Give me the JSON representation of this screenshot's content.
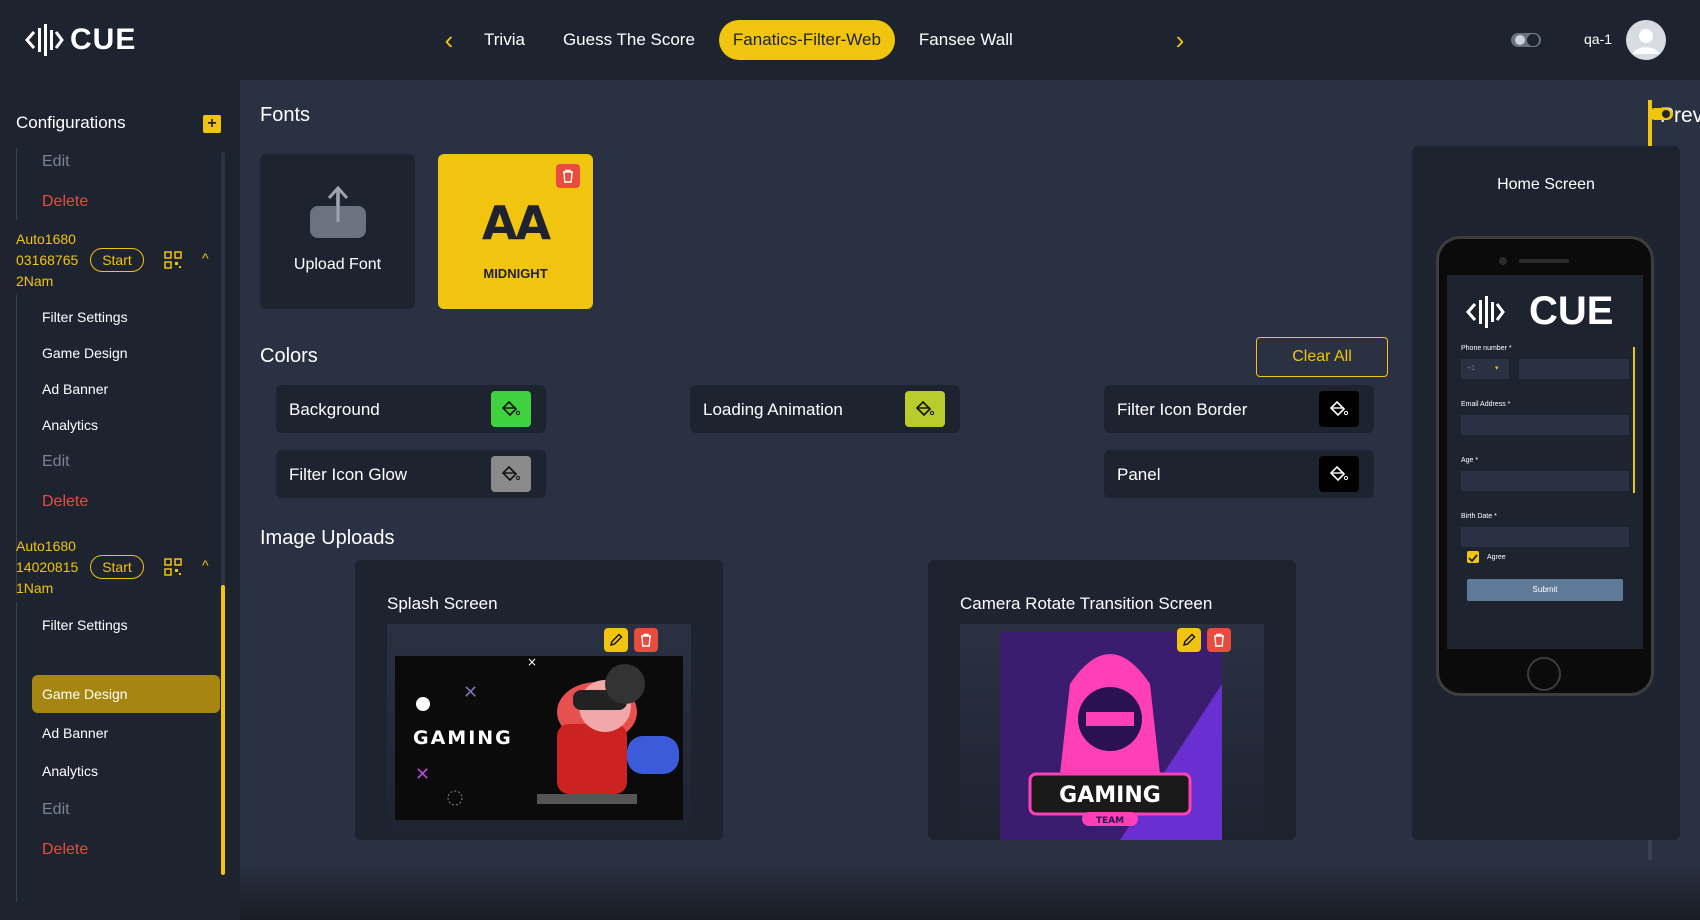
{
  "header": {
    "logo_text": "CUE",
    "tabs": [
      "Trivia",
      "Guess The Score",
      "Fanatics-Filter-Web",
      "Fansee Wall"
    ],
    "active_tab": "Fanatics-Filter-Web",
    "username": "qa-1"
  },
  "sidebar": {
    "title": "Configurations",
    "top_group": {
      "edit": "Edit",
      "delete": "Delete"
    },
    "configs": [
      {
        "name_lines": [
          "Auto1680",
          "03168765",
          "2Nam"
        ],
        "start_label": "Start",
        "items": [
          "Filter Settings",
          "Game Design",
          "Ad Banner",
          "Analytics"
        ],
        "edit": "Edit",
        "delete": "Delete"
      },
      {
        "name_lines": [
          "Auto1680",
          "14020815",
          "1Nam"
        ],
        "start_label": "Start",
        "items": [
          "Filter Settings",
          "Game Design",
          "Ad Banner",
          "Analytics"
        ],
        "active_item": "Game Design",
        "edit": "Edit",
        "delete": "Delete"
      }
    ]
  },
  "fonts": {
    "title": "Fonts",
    "upload_label": "Upload Font",
    "font_sample": "AA",
    "font_name": "MIDNIGHT"
  },
  "colors": {
    "title": "Colors",
    "clear_all": "Clear All",
    "items": [
      {
        "label": "Background",
        "swatch": "#3fd13f"
      },
      {
        "label": "Loading Animation",
        "swatch": "#b8cc2c"
      },
      {
        "label": "Filter Icon Border",
        "swatch": "#000000"
      },
      {
        "label": "Filter Icon Glow",
        "swatch": "#8a8a8a"
      },
      {
        "label": "Panel",
        "swatch": "#000000"
      }
    ]
  },
  "image_uploads": {
    "title": "Image Uploads",
    "cards": [
      {
        "title": "Splash Screen",
        "art_text": "GAMING"
      },
      {
        "title": "Camera Rotate Transition Screen",
        "art_text": "GAMING",
        "art_sub": "TEAM"
      }
    ]
  },
  "preview": {
    "title": "Preview",
    "screen_title": "Home Screen",
    "phone_logo": "CUE",
    "form": {
      "phone_label": "Phone number *",
      "country_code": "+1",
      "email_label": "Email Address *",
      "age_label": "Age *",
      "birth_label": "Birth Date *",
      "agree_label": "Agree",
      "submit_label": "Submit"
    }
  },
  "theme": {
    "accent": "#f1c40f",
    "danger": "#e74c3c",
    "bg": "#2a3142",
    "panel": "#1e2330"
  }
}
